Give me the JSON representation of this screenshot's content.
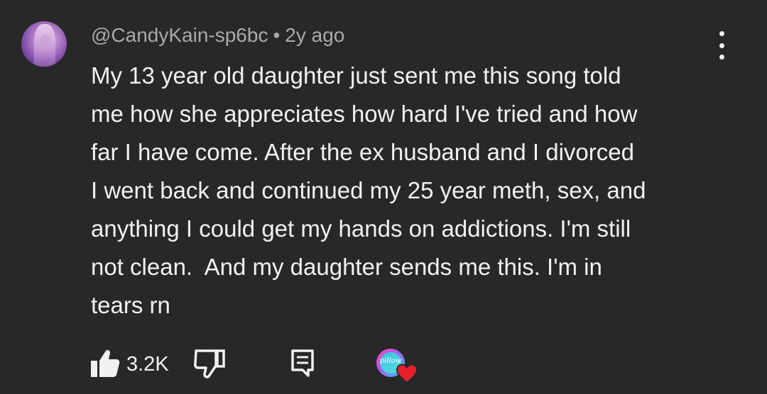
{
  "comment": {
    "author": "@CandyKain-sp6bc",
    "separator": "•",
    "time": "2y ago",
    "text": "My 13 year old daughter just sent me this song told\nme how she appreciates how hard I've tried and how\nfar I have come. After the ex husband and I divorced\nI went back and continued my 25 year meth, sex, and\nanything I could get my hands on addictions. I'm still\nnot clean.  And my daughter sends me this. I'm in\ntears rn"
  },
  "actions": {
    "like_icon": "thumbs-up-filled-icon",
    "like_count": "3.2K",
    "dislike_icon": "thumbs-down-outline-icon",
    "reply_icon": "comment-reply-icon",
    "creator_heart_icon": "creator-heart-icon",
    "creator_logo_text": "pillow"
  },
  "colors": {
    "background": "#282828",
    "primary_text": "#f1f1f1",
    "secondary_text": "#aaaaaa",
    "heart": "#e8202a"
  }
}
